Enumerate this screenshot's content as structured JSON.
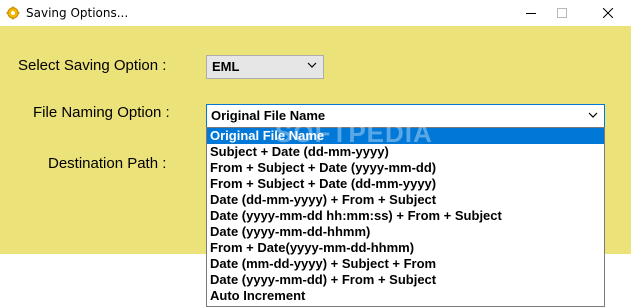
{
  "window": {
    "title": "Saving Options...",
    "icon": "gear-icon",
    "controls": [
      "minimize-icon",
      "maximize-icon",
      "close-icon"
    ]
  },
  "form": {
    "saving_option_label": "Select Saving Option :",
    "saving_option_value": "EML",
    "file_naming_label": "File Naming Option :",
    "file_naming_value": "Original File Name",
    "destination_label": "Destination Path :"
  },
  "dropdown": {
    "selected_index": 0,
    "options": [
      "Original File Name",
      "Subject + Date (dd-mm-yyyy)",
      "From + Subject + Date (yyyy-mm-dd)",
      "From + Subject + Date (dd-mm-yyyy)",
      "Date (dd-mm-yyyy) + From + Subject",
      "Date (yyyy-mm-dd hh:mm:ss) + From + Subject",
      "Date (yyyy-mm-dd-hhmm)",
      "From + Date(yyyy-mm-dd-hhmm)",
      "Date (mm-dd-yyyy) + Subject + From",
      "Date (yyyy-mm-dd) + From + Subject",
      "Auto Increment"
    ]
  },
  "watermark": "SOFTPEDIA",
  "colors": {
    "panel_bg": "#ece27a",
    "selection": "#0078d7",
    "focus_border": "#0078d7"
  }
}
